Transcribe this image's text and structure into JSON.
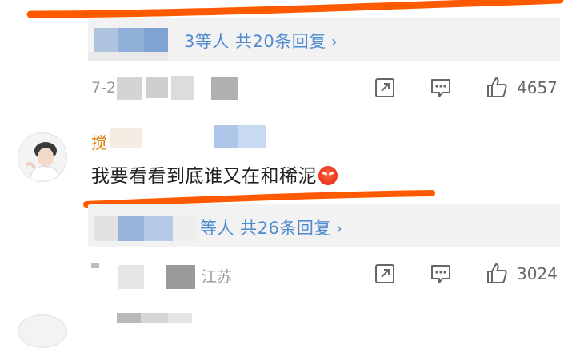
{
  "thread1": {
    "reply_summary": "3等人 共20条回复",
    "chevron": "›",
    "meta_visible": "7-2",
    "like_count": "4657"
  },
  "comment2": {
    "username_visible": "搅",
    "text": "我要看看到底谁又在和稀泥",
    "emoji_icon": "angry-face-emoji",
    "reply_summary": "等人 共26条回复",
    "chevron": "›",
    "location_visible": "江苏",
    "like_count": "3024"
  },
  "colors": {
    "highlight_stroke": "#ff5a00",
    "link_blue": "#4f8ccf",
    "username_orange": "#e07b00",
    "reply_bar_bg": "#f2f2f2"
  },
  "icons": [
    "share-icon",
    "comment-icon",
    "like-icon",
    "chevron-right-icon",
    "avatar"
  ]
}
